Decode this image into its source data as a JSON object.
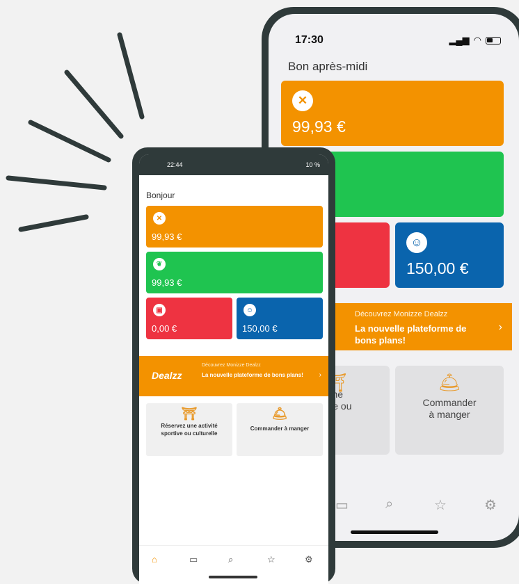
{
  "colors": {
    "orange": "#f39200",
    "green": "#1fc450",
    "red": "#ee3341",
    "blue": "#0a64ad",
    "frame": "#2f3a3a"
  },
  "iphone": {
    "time": "17:30",
    "greeting": "Bon après-midi",
    "cards": [
      {
        "amount": "99,93 €",
        "icon": "fork-knife-icon"
      },
      {
        "amount": "€",
        "icon": "leaf-icon"
      },
      {
        "amount": "€",
        "icon": "gift-icon"
      },
      {
        "amount": "150,00 €",
        "icon": "person-icon"
      }
    ],
    "banner": {
      "kicker": "Découvrez Monizze Dealzz",
      "headline": "La nouvelle plateforme de bons plans!",
      "chevron": "›"
    },
    "tiles": [
      {
        "label": "vez une\nportive ou\nurelle"
      },
      {
        "label": "Commander\nà manger"
      }
    ],
    "tabbar": [
      "card-icon",
      "search-icon",
      "star-icon",
      "settings-icon"
    ]
  },
  "android": {
    "time": "22:44",
    "battery": "10 %",
    "greeting": "Bonjour",
    "cards": [
      {
        "amount": "99,93 €",
        "icon": "fork-knife-icon"
      },
      {
        "amount": "99,93 €",
        "icon": "leaf-icon"
      },
      {
        "amount": "0,00 €",
        "icon": "gift-icon"
      },
      {
        "amount": "150,00 €",
        "icon": "person-icon"
      }
    ],
    "banner": {
      "logo": "Dealzz",
      "kicker": "Découvrez Monizze Dealzz",
      "headline": "La nouvelle plateforme de bons plans!",
      "chevron": "›"
    },
    "tiles": [
      {
        "label": "Réservez une activité sportive ou culturelle"
      },
      {
        "label": "Commander à manger"
      }
    ],
    "tabbar": [
      "home-icon",
      "card-icon",
      "search-icon",
      "star-icon",
      "settings-icon"
    ]
  }
}
